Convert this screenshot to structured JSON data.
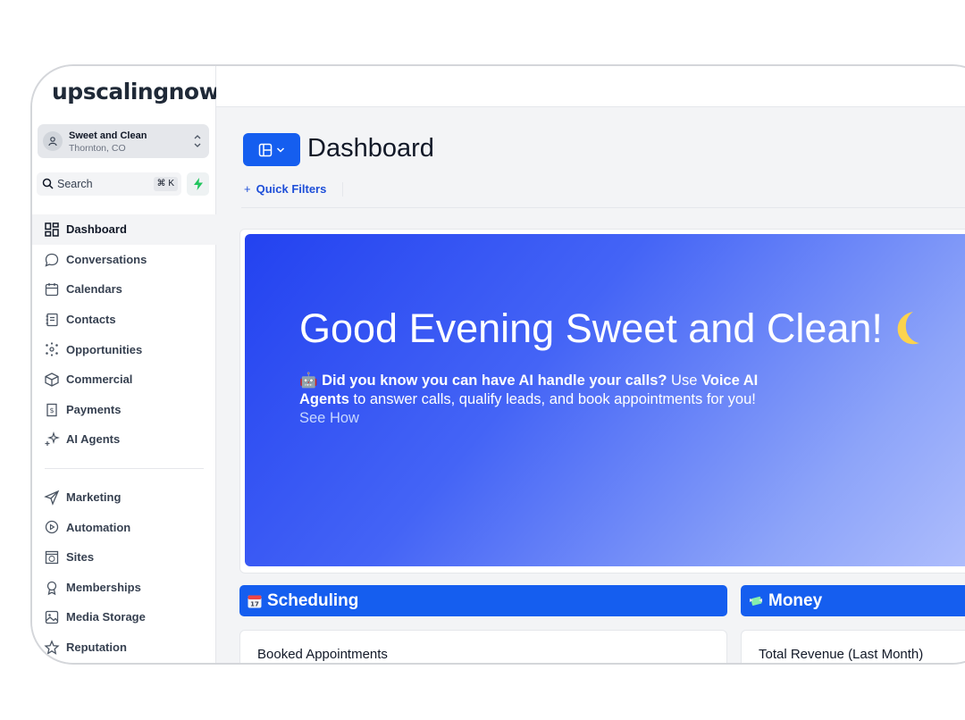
{
  "brand": {
    "logo_text": "upscalingnow"
  },
  "account": {
    "name": "Sweet and Clean",
    "location": "Thornton, CO"
  },
  "search": {
    "label": "Search",
    "shortcut": "⌘ K"
  },
  "sidebar": {
    "items": [
      {
        "label": "Dashboard",
        "icon": "dashboard-icon",
        "active": true
      },
      {
        "label": "Conversations",
        "icon": "chat-bubble-icon"
      },
      {
        "label": "Calendars",
        "icon": "calendar-icon"
      },
      {
        "label": "Contacts",
        "icon": "contacts-icon"
      },
      {
        "label": "Opportunities",
        "icon": "opportunities-icon"
      },
      {
        "label": "Commercial",
        "icon": "box-icon"
      },
      {
        "label": "Payments",
        "icon": "receipt-icon"
      },
      {
        "label": "AI Agents",
        "icon": "sparkle-icon"
      }
    ],
    "items2": [
      {
        "label": "Marketing",
        "icon": "send-icon"
      },
      {
        "label": "Automation",
        "icon": "automation-icon"
      },
      {
        "label": "Sites",
        "icon": "globe-window-icon"
      },
      {
        "label": "Memberships",
        "icon": "award-icon"
      },
      {
        "label": "Media Storage",
        "icon": "image-icon"
      },
      {
        "label": "Reputation",
        "icon": "star-icon"
      }
    ]
  },
  "header": {
    "title": "Dashboard",
    "quick_filters": "Quick Filters"
  },
  "hero": {
    "greeting": "Good Evening Sweet and Clean!",
    "tip_emoji": "🤖",
    "tip_bold": "Did you know you can have AI handle your calls?",
    "tip_use": "Use",
    "tip_bold2": "Voice AI Agents",
    "tip_rest": "to answer calls, qualify leads, and book appointments for you!",
    "tip_link": "See How"
  },
  "sections": {
    "scheduling": {
      "label": "Scheduling",
      "emoji": "calendar-emoji"
    },
    "money": {
      "label": "Money",
      "emoji": "money-wings-emoji"
    }
  },
  "cards": {
    "booked": "Booked Appointments",
    "revenue": "Total Revenue (Last Month)"
  },
  "colors": {
    "accent": "#155eef",
    "hero_start": "#2342f0",
    "hero_end": "#b7c4fd"
  }
}
